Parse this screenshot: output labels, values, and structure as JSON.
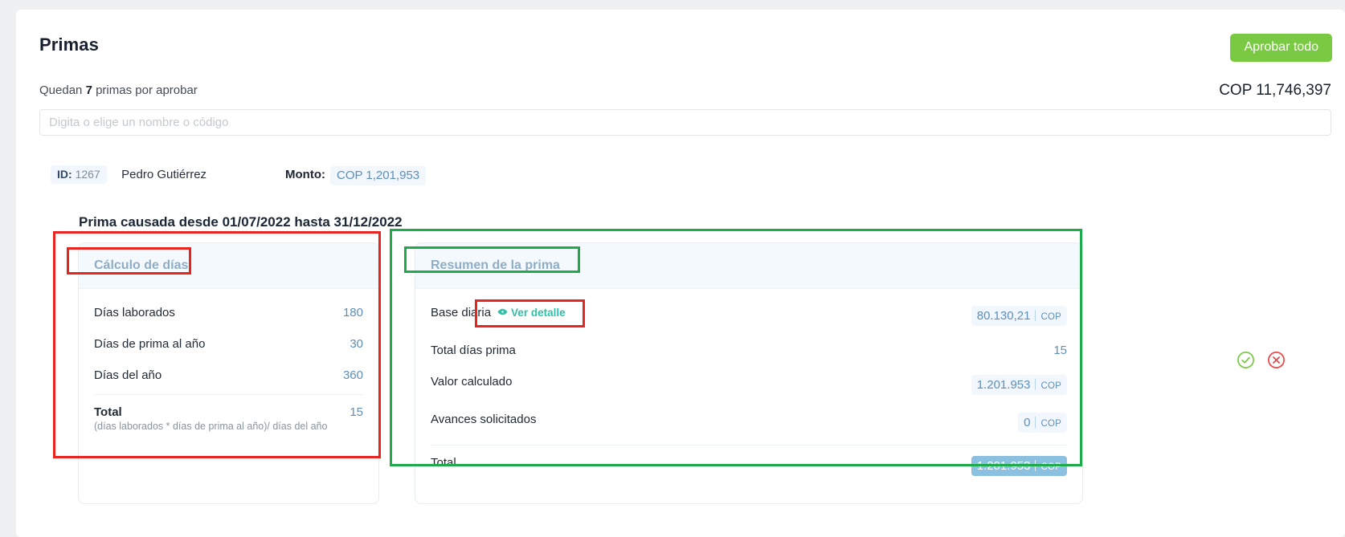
{
  "header": {
    "title": "Primas",
    "approve_all_label": "Aprobar todo",
    "remaining_prefix": "Quedan",
    "remaining_count": "7",
    "remaining_suffix": "primas por aprobar",
    "grand_total": "COP 11,746,397",
    "accent_green": "#7ac943"
  },
  "search": {
    "value": "",
    "placeholder": "Digita o elige un nombre o código"
  },
  "record": {
    "id_label": "ID:",
    "id_value": "1267",
    "employee_name": "Pedro Gutiérrez",
    "monto_label": "Monto:",
    "monto_value": "COP 1,201,953",
    "section_title": "Prima causada desde 01/07/2022 hasta 31/12/2022"
  },
  "card_days": {
    "title": "Cálculo de días",
    "rows": [
      {
        "label": "Días laborados",
        "value": "180"
      },
      {
        "label": "Días de prima al año",
        "value": "30"
      },
      {
        "label": "Días del año",
        "value": "360"
      }
    ],
    "total": {
      "label": "Total",
      "formula": "(días laborados * días de prima al año)/ días del año",
      "value": "15"
    }
  },
  "card_summary": {
    "title": "Resumen de la prima",
    "rows": [
      {
        "label": "Base diaria",
        "link": "Ver detalle",
        "link_icon": "eye-icon",
        "value": "80.130,21",
        "currency": "COP",
        "style": "chip"
      },
      {
        "label": "Total días prima",
        "value": "15",
        "currency": "",
        "style": "plain"
      },
      {
        "label": "Valor calculado",
        "value": "1.201.953",
        "currency": "COP",
        "style": "chip"
      },
      {
        "label": "Avances solicitados",
        "value": "0",
        "currency": "COP",
        "style": "chip"
      }
    ],
    "total": {
      "label": "Total",
      "value": "1.201.953",
      "currency": "COP",
      "style": "chip-solid"
    }
  },
  "actions": {
    "approve_icon": "check-circle-icon",
    "reject_icon": "x-circle-icon",
    "approve_color": "#7ac943",
    "reject_color": "#ef4444"
  },
  "annotations": {
    "red_color": "#e8241f",
    "green_color": "#1faa4b"
  }
}
